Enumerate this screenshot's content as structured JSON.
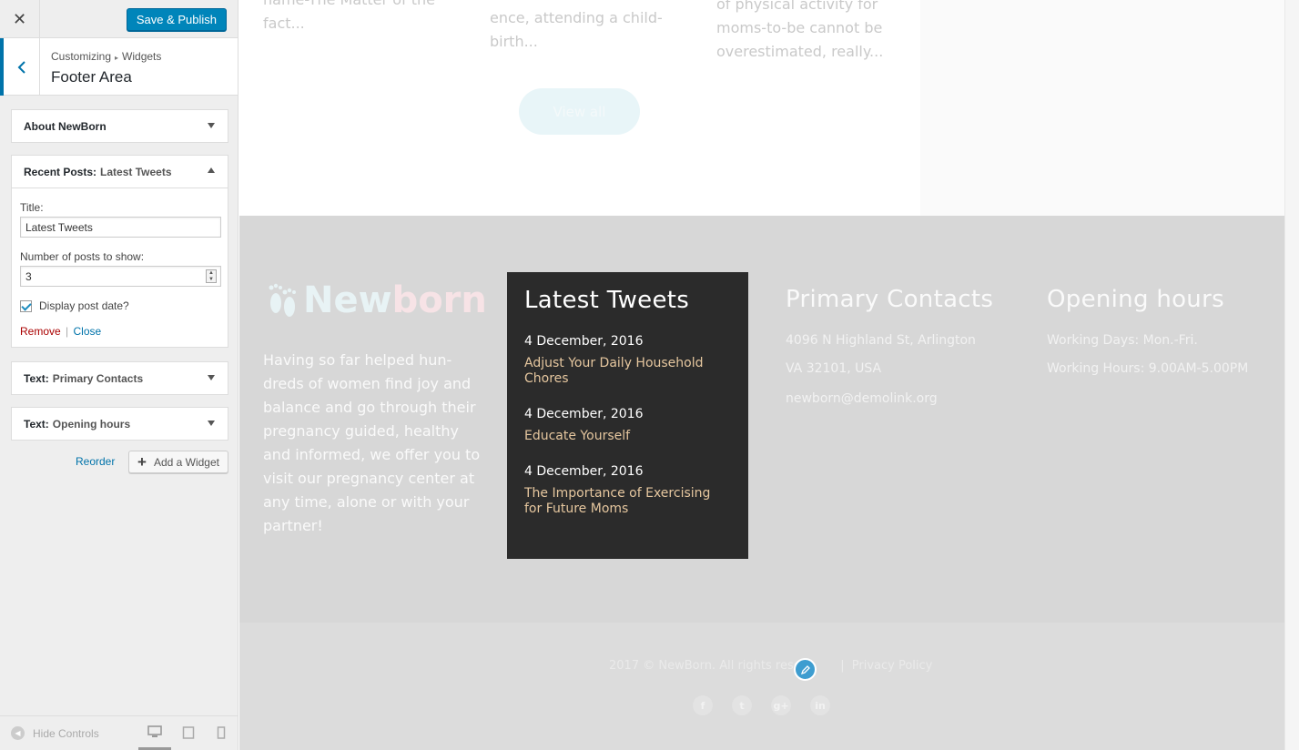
{
  "sidebar": {
    "close_label": "✕",
    "publish_label": "Save & Publish",
    "breadcrumb": {
      "root": "Customizing",
      "current": "Widgets"
    },
    "panel_title": "Footer Area",
    "widgets": [
      {
        "type": "About NewBorn",
        "subtitle": ""
      },
      {
        "type": "Recent Posts:",
        "subtitle": "Latest Tweets"
      },
      {
        "type": "Text:",
        "subtitle": "Primary Contacts"
      },
      {
        "type": "Text:",
        "subtitle": "Opening hours"
      }
    ],
    "form": {
      "title_label": "Title:",
      "title_value": "Latest Tweets",
      "count_label": "Number of posts to show:",
      "count_value": "3",
      "show_date_label": "Display post date?",
      "show_date_checked": true,
      "remove_label": "Remove",
      "sep": "|",
      "close_label": "Close"
    },
    "reorder_label": "Reorder",
    "add_widget_label": "Add a Widget",
    "hide_controls_label": "Hide Controls"
  },
  "preview": {
    "post_tails": [
      {
        "lines": [
          "name-The Matter of the",
          "fact..."
        ]
      },
      {
        "lines": [
          "ence, attending a child-",
          "birth..."
        ]
      },
      {
        "lines": [
          "of physical activity for",
          "moms-to-be cannot be",
          "overestimated, really..."
        ]
      }
    ],
    "view_all_label": "View all",
    "logo": {
      "part1": "New",
      "part2": "born"
    },
    "about_text": "Having so far helped hun-dreds of women find joy and balance and go through their pregnancy guided, healthy and informed, we offer you to visit our pregnancy center at any time, alone or with your partner!",
    "tweets": {
      "title": "Latest Tweets",
      "items": [
        {
          "date": "4 December, 2016",
          "title": "Adjust Your Daily Household Chores"
        },
        {
          "date": "4 December, 2016",
          "title": "Educate Yourself"
        },
        {
          "date": "4 December, 2016",
          "title": "The Importance of Exercising for Future Moms"
        }
      ]
    },
    "contacts": {
      "title": "Primary Contacts",
      "address1": "4096 N Highland St, Arlington",
      "address2": "VA 32101, USA",
      "email": "newborn@demolink.org"
    },
    "hours": {
      "title": "Opening hours",
      "days": "Working Days: Mon.-Fri.",
      "time": "Working Hours: 9.00AM-5.00PM"
    },
    "copyright": "2017 © NewBorn. All rights reser",
    "copyright_sep": "|",
    "privacy_label": "Privacy Policy",
    "socials": [
      "f",
      "t",
      "g+",
      "in"
    ]
  },
  "colors": {
    "accent": "#0085ba",
    "tweet_link": "#e6c79f",
    "footer_bg": "#d7d7d7",
    "tweets_bg": "#2b2b2b"
  }
}
